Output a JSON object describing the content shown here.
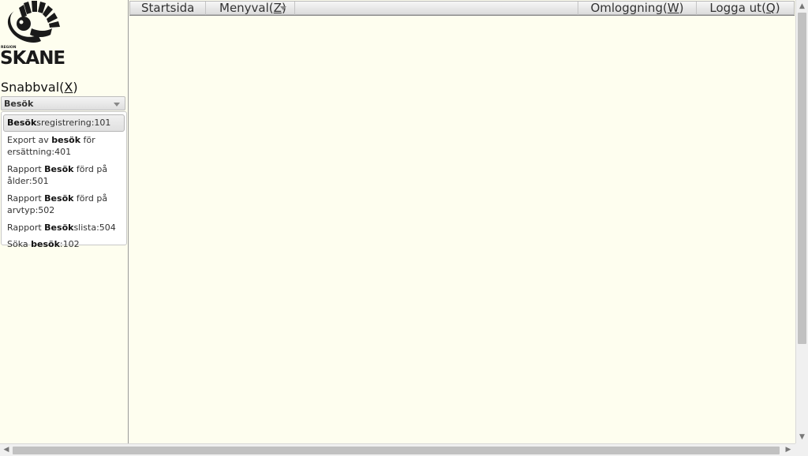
{
  "brand": {
    "region_label": "REGION",
    "name": "SKANE"
  },
  "quick_select": {
    "title": "Snabbval",
    "shortcut": "X",
    "selected": "Besök",
    "items": [
      {
        "pre": "",
        "bold": "Besök",
        "post": "sregistrering:101"
      },
      {
        "pre": "Export av ",
        "bold": "besök",
        "post": " för ersättning:401"
      },
      {
        "pre": "Rapport ",
        "bold": "Besök",
        "post": " förd på ålder:501"
      },
      {
        "pre": "Rapport ",
        "bold": "Besök",
        "post": " förd på arvtyp:502"
      },
      {
        "pre": "Rapport ",
        "bold": "Besök",
        "post": "slista:504"
      },
      {
        "pre": "Söka ",
        "bold": "besök",
        "post": ":102"
      }
    ]
  },
  "topnav": {
    "start": "Startsida",
    "menu": "Menyval",
    "menu_shortcut": "Z",
    "relogin": "Omloggning",
    "relogin_shortcut": "W",
    "logout": "Logga ut",
    "logout_shortcut": "Q"
  },
  "icons": {
    "logo": "region-skane-griffin-logo",
    "menu_arrow": "chevron-down-icon",
    "scroll_up": "scroll-up-arrow-icon",
    "scroll_down": "scroll-down-arrow-icon",
    "scroll_left": "scroll-left-arrow-icon",
    "scroll_right": "scroll-right-arrow-icon"
  },
  "colors": {
    "background": "#fefeef",
    "scrollbar": "#c1c1c1"
  }
}
